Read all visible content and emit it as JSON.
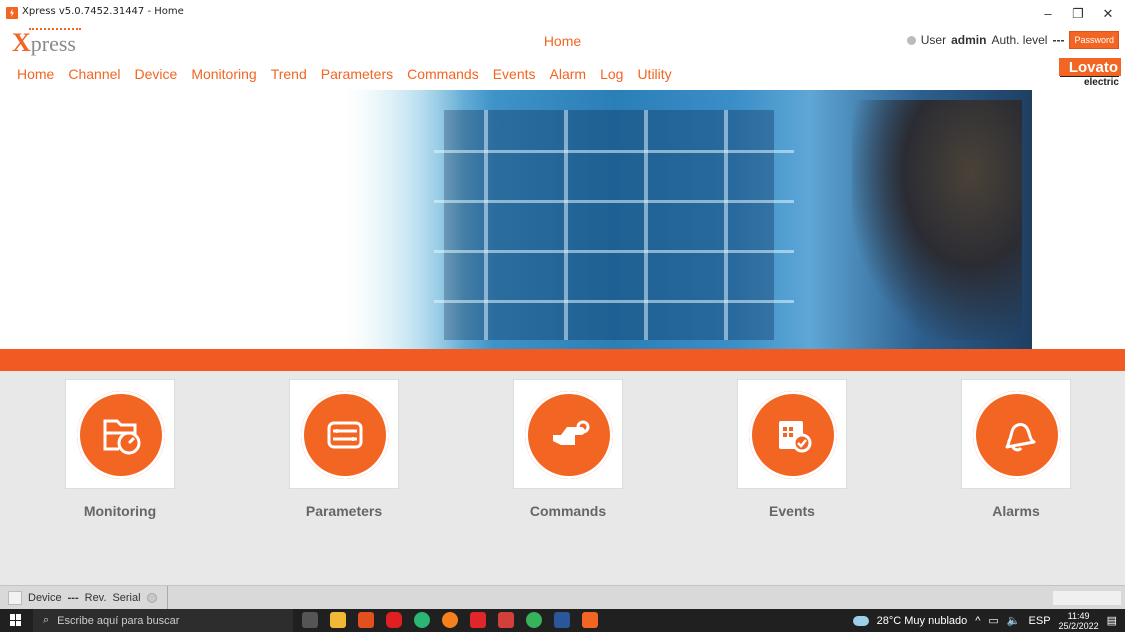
{
  "window": {
    "title": "Xpress v5.0.7452.31447 - Home",
    "minimize": "–",
    "maximize": "❐",
    "close": "✕"
  },
  "header": {
    "logo_x": "X",
    "logo_rest": "press",
    "page_title": "Home",
    "user_label": "User",
    "user_name": "admin",
    "auth_label": "Auth. level",
    "auth_value": "---",
    "password_button": "Password"
  },
  "menu": {
    "items": [
      "Home",
      "Channel",
      "Device",
      "Monitoring",
      "Trend",
      "Parameters",
      "Commands",
      "Events",
      "Alarm",
      "Log",
      "Utility"
    ]
  },
  "brand": {
    "name": "Lovato",
    "sub": "electric",
    "accent": "#f26522"
  },
  "tiles": [
    {
      "label": "Monitoring",
      "icon": "folder-gauge-icon"
    },
    {
      "label": "Parameters",
      "icon": "wrench-screwdriver-icon"
    },
    {
      "label": "Commands",
      "icon": "pointing-hand-icon"
    },
    {
      "label": "Events",
      "icon": "calendar-check-icon"
    },
    {
      "label": "Alarms",
      "icon": "bell-icon"
    }
  ],
  "status": {
    "device_label": "Device",
    "device_value": "---",
    "rev_label": "Rev.",
    "serial_label": "Serial"
  },
  "taskbar": {
    "search_placeholder": "Escribe aquí para buscar",
    "weather": "28°C  Muy nublado",
    "lang": "ESP",
    "time": "11:49",
    "date": "25/2/2022"
  }
}
